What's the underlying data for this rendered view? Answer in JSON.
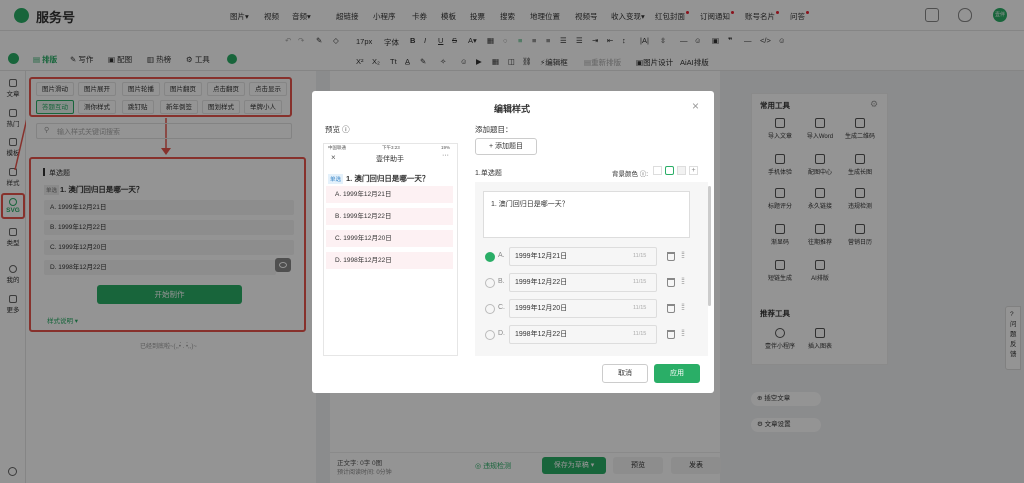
{
  "header": {
    "brand": "服务号",
    "nav": [
      {
        "label": "图片",
        "caret": true
      },
      {
        "label": "视频",
        "caret": false
      },
      {
        "label": "音频",
        "caret": true
      },
      {
        "label": "超链接",
        "caret": false
      },
      {
        "label": "小程序",
        "caret": false
      },
      {
        "label": "卡券",
        "caret": false
      },
      {
        "label": "模板",
        "caret": false
      },
      {
        "label": "投票",
        "caret": false
      },
      {
        "label": "搜索",
        "caret": false
      },
      {
        "label": "地理位置",
        "caret": false
      },
      {
        "label": "视频号",
        "caret": false
      },
      {
        "label": "收入变现",
        "caret": true
      },
      {
        "label": "红包封面",
        "dot": true
      },
      {
        "label": "订阅通知",
        "dot": true
      },
      {
        "label": "账号名片",
        "dot": true
      },
      {
        "label": "问答",
        "dot": true
      }
    ],
    "avatar_text": "壹伴"
  },
  "toolbar": {
    "font_size": "17px",
    "font_label": "字体",
    "row2_labels": [
      "编辑框",
      "重新排版",
      "图片设计",
      "AI排版"
    ]
  },
  "tabs": [
    {
      "label": "排版",
      "active": true
    },
    {
      "label": "写作",
      "active": false
    },
    {
      "label": "配图",
      "active": false
    },
    {
      "label": "热榜",
      "active": false
    },
    {
      "label": "工具",
      "active": false
    }
  ],
  "rail": [
    {
      "label": "文章"
    },
    {
      "label": "热门"
    },
    {
      "label": "模板"
    },
    {
      "label": "样式"
    },
    {
      "label": "SVG",
      "active": true
    },
    {
      "label": "类型"
    },
    {
      "label": "我的"
    },
    {
      "label": "更多"
    }
  ],
  "style_tags": {
    "row1": [
      "图片滑动",
      "图片展开",
      "图片轮播",
      "图片翻页",
      "点击翻页",
      "点击显示"
    ],
    "row2": [
      "答题互动",
      "测你样式",
      "跳钉贴",
      "新年倒签",
      "图划样式",
      "举牌小人"
    ]
  },
  "left_panel": {
    "search_placeholder": "输入样式关键词搜索",
    "card_title": "单选题",
    "question_badge": "单选",
    "question": "1. 澳门回归日是哪一天？",
    "options": [
      "A. 1999年12月21日",
      "B. 1999年12月22日",
      "C. 1999年12月20日",
      "D. 1998年12月22日"
    ],
    "start_button": "开始制作",
    "style_desc": "样式说明",
    "bottom_note": "已经到底啦~(,,•́ . •̀,,)~"
  },
  "editor_footer": {
    "word_count": "正文字:  0字 0图",
    "read_time": "预计阅读时间:  0分钟",
    "check": "违规检测",
    "save_draft": "保存为草稿",
    "preview": "预览",
    "publish": "发表"
  },
  "right_panel": {
    "title": "常用工具",
    "tools": [
      "导入文章",
      "导入Word",
      "生成二维码",
      "手机体验",
      "配图中心",
      "生成长图",
      "标题评分",
      "永久链接",
      "违规检测",
      "渐显码",
      "往期推荐",
      "营销日历",
      "短链生成",
      "AI排版"
    ],
    "rec_title": "推荐工具",
    "rec_tools": [
      "壹伴小程序",
      "插入图表"
    ],
    "tail_items": [
      "插空文章",
      "文章设置"
    ]
  },
  "help_tab": "问题反馈",
  "modal": {
    "title": "编辑样式",
    "preview_label": "预览",
    "add_title_label": "添加题目：",
    "add_title_button": "+ 添加题目",
    "section_title": "1.单选题",
    "bg_color_label": "背景颜色",
    "question_text": "1. 澳门回归日是哪一天？",
    "options": [
      {
        "letter": "A.",
        "value": "1999年12月21日",
        "count": "11/15",
        "checked": true
      },
      {
        "letter": "B.",
        "value": "1999年12月22日",
        "count": "11/15",
        "checked": false
      },
      {
        "letter": "C.",
        "value": "1999年12月20日",
        "count": "11/15",
        "checked": false
      },
      {
        "letter": "D.",
        "value": "1998年12月22日",
        "count": "11/15",
        "checked": false
      }
    ],
    "cancel": "取消",
    "apply": "应用"
  },
  "phone": {
    "status_left": "中国联通",
    "status_time": "下午3:23",
    "status_right": "19%",
    "title": "壹伴助手",
    "badge": "单选",
    "question": "1. 澳门回归日是哪一天？",
    "options": [
      "A. 1999年12月21日",
      "B. 1999年12月22日",
      "C. 1999年12月20日",
      "D. 1998年12月22日"
    ]
  },
  "colors": {
    "brand_green": "#2aae67",
    "annotation_red": "#e8554d",
    "option_pink": "#fdf1f3"
  }
}
